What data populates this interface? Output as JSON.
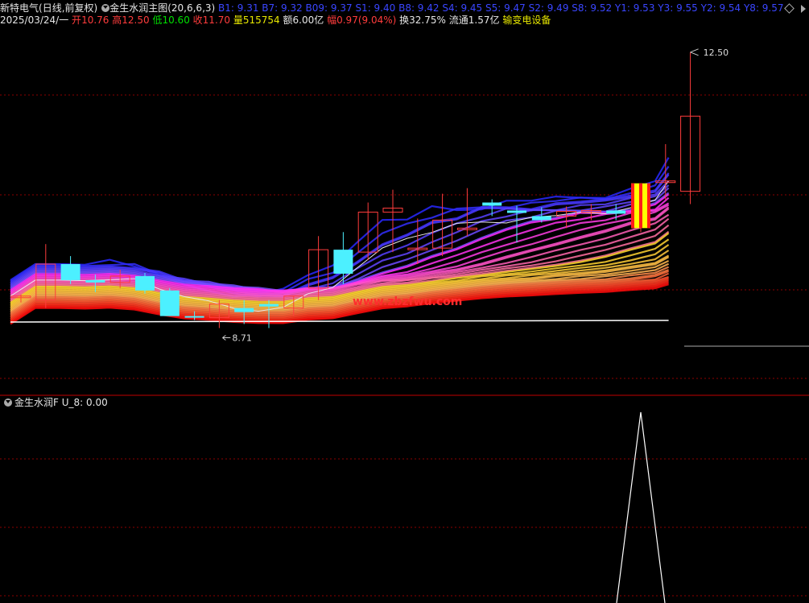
{
  "header1": {
    "stock_name": "新特电气",
    "period": "(日线,前复权)",
    "indicator_name": "金生水润主图",
    "indicator_params": "(20,6,6,3)",
    "ma_values": "B1: 9.31  B7: 9.32  B09: 9.37  S1: 9.40  B8: 9.42  S4: 9.45  S5: 9.47  S2: 9.49  S8: 9.52  Y1: 9.53  Y3: 9.55  Y2: 9.54  Y8: 9.57"
  },
  "header2": {
    "date": "2025/03/24/一",
    "open_label": "开",
    "open_value": "10.76",
    "high_label": "高",
    "high_value": "12.50",
    "low_label": "低",
    "low_value": "10.60",
    "close_label": "收",
    "close_value": "11.70",
    "volume_label": "量",
    "volume_value": "515754",
    "amount_label": "额",
    "amount_value": "6.00亿",
    "change_label": "幅",
    "change_value": "0.97(9.04%)",
    "turnover_label": "换",
    "turnover_value": "32.75%",
    "float_label": "流通",
    "float_value": "1.57亿",
    "sector": "输变电设备"
  },
  "indicator_panel": {
    "name": "金生水润F",
    "value_text": "U_8: 0.00"
  },
  "annotations": {
    "high_marker": "12.50",
    "low_marker": "8.71",
    "watermark": "www.zbzfwu.com"
  },
  "colors": {
    "up": "#ff3c3c",
    "down": "#4cf0ff",
    "limit_up_fill": "#ffff00",
    "limit_up_stripe": "#ff1a1a",
    "grid": "#8b0000",
    "background": "#000000"
  },
  "chart_data": [
    {
      "type": "candlestick",
      "title": "金生水润主图",
      "ylim": [
        8.3,
        12.8
      ],
      "x": [
        "d1",
        "d2",
        "d3",
        "d4",
        "d5",
        "d6",
        "d7",
        "d8",
        "d9",
        "d10",
        "d11",
        "d12",
        "d13",
        "d14",
        "d15",
        "d16",
        "d17",
        "d18",
        "d19",
        "d20",
        "d21",
        "d22",
        "d23",
        "d24",
        "d25",
        "d26",
        "d27",
        "d28"
      ],
      "ohlc": [
        [
          9.45,
          9.47,
          9.37,
          9.45
        ],
        [
          9.4,
          10.1,
          9.3,
          9.85
        ],
        [
          9.85,
          9.95,
          9.6,
          9.65
        ],
        [
          9.65,
          9.72,
          9.5,
          9.62
        ],
        [
          9.62,
          9.78,
          9.55,
          9.7
        ],
        [
          9.7,
          9.74,
          9.48,
          9.52
        ],
        [
          9.52,
          9.55,
          9.2,
          9.2
        ],
        [
          9.2,
          9.26,
          9.15,
          9.18
        ],
        [
          9.18,
          9.4,
          9.05,
          9.35
        ],
        [
          9.3,
          9.4,
          9.1,
          9.25
        ],
        [
          9.35,
          9.4,
          9.05,
          9.32
        ],
        [
          9.3,
          9.45,
          9.2,
          9.45
        ],
        [
          9.55,
          10.2,
          9.4,
          10.03
        ],
        [
          10.03,
          10.25,
          9.6,
          9.73
        ],
        [
          10.0,
          10.62,
          9.9,
          10.5
        ],
        [
          10.5,
          10.78,
          10.0,
          10.55
        ],
        [
          10.05,
          10.42,
          9.85,
          10.05
        ],
        [
          10.05,
          10.73,
          9.95,
          10.4
        ],
        [
          10.3,
          10.8,
          10.2,
          10.3
        ],
        [
          10.62,
          10.66,
          10.45,
          10.58
        ],
        [
          10.52,
          10.58,
          10.12,
          10.49
        ],
        [
          10.45,
          10.56,
          10.37,
          10.4
        ],
        [
          10.45,
          10.57,
          10.3,
          10.51
        ],
        [
          10.52,
          10.6,
          10.4,
          10.52
        ],
        [
          10.52,
          10.6,
          10.4,
          10.48
        ],
        [
          10.3,
          10.86,
          10.25,
          10.86
        ],
        [
          10.88,
          11.35,
          10.65,
          10.89
        ],
        [
          10.76,
          12.5,
          10.6,
          11.7
        ]
      ],
      "annotations": [
        "12.50",
        "8.71"
      ]
    },
    {
      "type": "line",
      "title": "金生水润F",
      "ylim": [
        0,
        1
      ],
      "x": [
        "d1",
        "d2",
        "d3",
        "d4",
        "d5",
        "d6",
        "d7",
        "d8",
        "d9",
        "d10",
        "d11",
        "d12",
        "d13",
        "d14",
        "d15",
        "d16",
        "d17",
        "d18",
        "d19",
        "d20",
        "d21",
        "d22",
        "d23",
        "d24",
        "d25",
        "d26",
        "d27",
        "d28"
      ],
      "series": [
        {
          "name": "U_8",
          "values": [
            0,
            0,
            0,
            0,
            0,
            0,
            0,
            0,
            0,
            0,
            0,
            0,
            0,
            0,
            0,
            0,
            0,
            0,
            0,
            0,
            0,
            0,
            0,
            0,
            0,
            1,
            0,
            0
          ]
        }
      ]
    }
  ]
}
